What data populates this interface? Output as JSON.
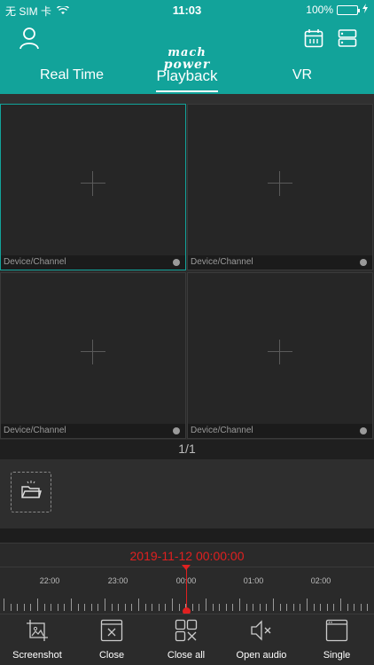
{
  "status_bar": {
    "carrier": "无 SIM 卡",
    "time": "11:03",
    "battery": "100%"
  },
  "header": {
    "logo_line1": "mach",
    "logo_line2": "power"
  },
  "tabs": [
    {
      "label": "Real Time",
      "active": false
    },
    {
      "label": "Playback",
      "active": true
    },
    {
      "label": "VR",
      "active": false
    }
  ],
  "channels": [
    {
      "label": "Device/Channel",
      "selected": true
    },
    {
      "label": "Device/Channel",
      "selected": false
    },
    {
      "label": "Device/Channel",
      "selected": false
    },
    {
      "label": "Device/Channel",
      "selected": false
    }
  ],
  "page_indicator": "1/1",
  "timeline": {
    "datetime": "2019-11-12 00:00:00",
    "ticks": [
      "22:00",
      "23:00",
      "00:00",
      "01:00",
      "02:00"
    ]
  },
  "toolbar": [
    {
      "label": "Screenshot",
      "icon": "screenshot-icon"
    },
    {
      "label": "Close",
      "icon": "close-window-icon"
    },
    {
      "label": "Close all",
      "icon": "close-all-icon"
    },
    {
      "label": "Open audio",
      "icon": "audio-muted-icon"
    },
    {
      "label": "Single",
      "icon": "single-window-icon"
    }
  ],
  "colors": {
    "accent": "#12a39a",
    "cursor": "#e02020"
  }
}
